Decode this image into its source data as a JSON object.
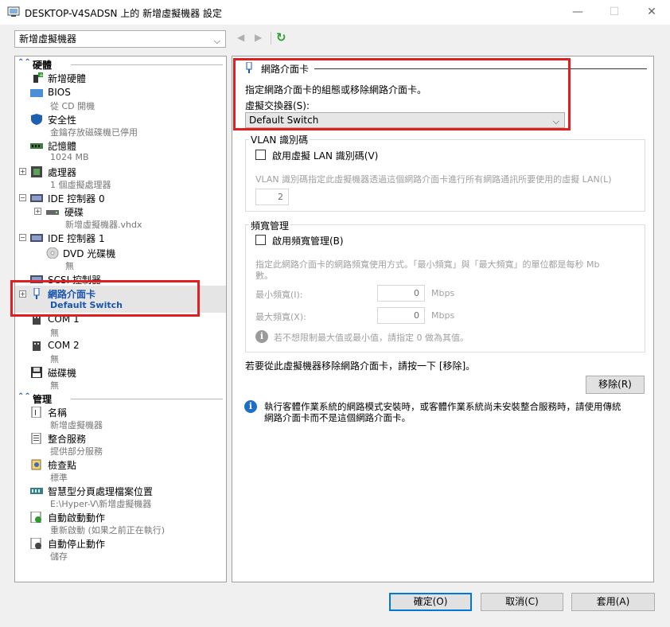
{
  "window": {
    "title": "DESKTOP-V4SADSN 上的 新增虛擬機器 設定",
    "minimize": "—",
    "maximize": "☐",
    "close": "✕"
  },
  "toolbar": {
    "vm_select": "新增虛擬機器",
    "back": "◀",
    "forward": "▶",
    "refresh": "↻"
  },
  "tree": {
    "hardware_header": "硬體",
    "management_header": "管理",
    "hardware": [
      {
        "label": "新增硬體",
        "sub": ""
      },
      {
        "label": "BIOS",
        "sub": "從 CD 開機"
      },
      {
        "label": "安全性",
        "sub": "金鑰存放磁碟機已停用"
      },
      {
        "label": "記憶體",
        "sub": "1024 MB"
      },
      {
        "label": "處理器",
        "sub": "1 個虛擬處理器"
      },
      {
        "label": "IDE 控制器 0",
        "sub": ""
      },
      {
        "label": "硬碟",
        "sub": "新增虛擬機器.vhdx"
      },
      {
        "label": "IDE 控制器 1",
        "sub": ""
      },
      {
        "label": "DVD 光碟機",
        "sub": "無"
      },
      {
        "label": "SCSI 控制器",
        "sub": ""
      },
      {
        "label": "網路介面卡",
        "sub": "Default Switch"
      },
      {
        "label": "COM 1",
        "sub": "無"
      },
      {
        "label": "COM 2",
        "sub": "無"
      },
      {
        "label": "磁碟機",
        "sub": "無"
      }
    ],
    "management": [
      {
        "label": "名稱",
        "sub": "新增虛擬機器"
      },
      {
        "label": "整合服務",
        "sub": "提供部分服務"
      },
      {
        "label": "檢查點",
        "sub": "標準"
      },
      {
        "label": "智慧型分頁處理檔案位置",
        "sub": "E:\\Hyper-V\\新增虛擬機器"
      },
      {
        "label": "自動啟動動作",
        "sub": "重新啟動 (如果之前正在執行)"
      },
      {
        "label": "自動停止動作",
        "sub": "儲存"
      }
    ]
  },
  "detail": {
    "section_title": "網路介面卡",
    "description": "指定網路介面卡的組態或移除網路介面卡。",
    "switch_label": "虛擬交換器(S):",
    "switch_value": "Default Switch",
    "vlan": {
      "title": "VLAN 識別碼",
      "checkbox": "啟用虛擬 LAN 識別碼(V)",
      "description": "VLAN 識別碼指定此虛擬機器透過這個網路介面卡進行所有網路通訊所要使用的虛擬 LAN(L)",
      "value": "2"
    },
    "bandwidth": {
      "title": "頻寬管理",
      "checkbox": "啟用頻寬管理(B)",
      "description_1": "指定此網路介面卡的網路頻寬使用方式。「最小頻寬」與「最大頻寬」的單位都是每秒 Mb",
      "description_2": "數。",
      "min_label": "最小頻寬(I):",
      "min_value": "0",
      "max_label": "最大頻寬(X):",
      "max_value": "0",
      "unit": "Mbps",
      "note": "若不想限制最大值或最小值，請指定 0 做為其值。"
    },
    "remove_text": "若要從此虛擬機器移除網路介面卡，請按一下 [移除]。",
    "remove_button": "移除(R)",
    "info_1": "執行客體作業系統的網路模式安裝時，或客體作業系統尚未安裝整合服務時，請使用傳統",
    "info_2": "網路介面卡而不是這個網路介面卡。"
  },
  "footer": {
    "ok": "確定(O)",
    "cancel": "取消(C)",
    "apply": "套用(A)"
  },
  "colors": {
    "accent": "#1a56b0",
    "highlight": "#e02020",
    "default_button_border": "#0078d7"
  }
}
